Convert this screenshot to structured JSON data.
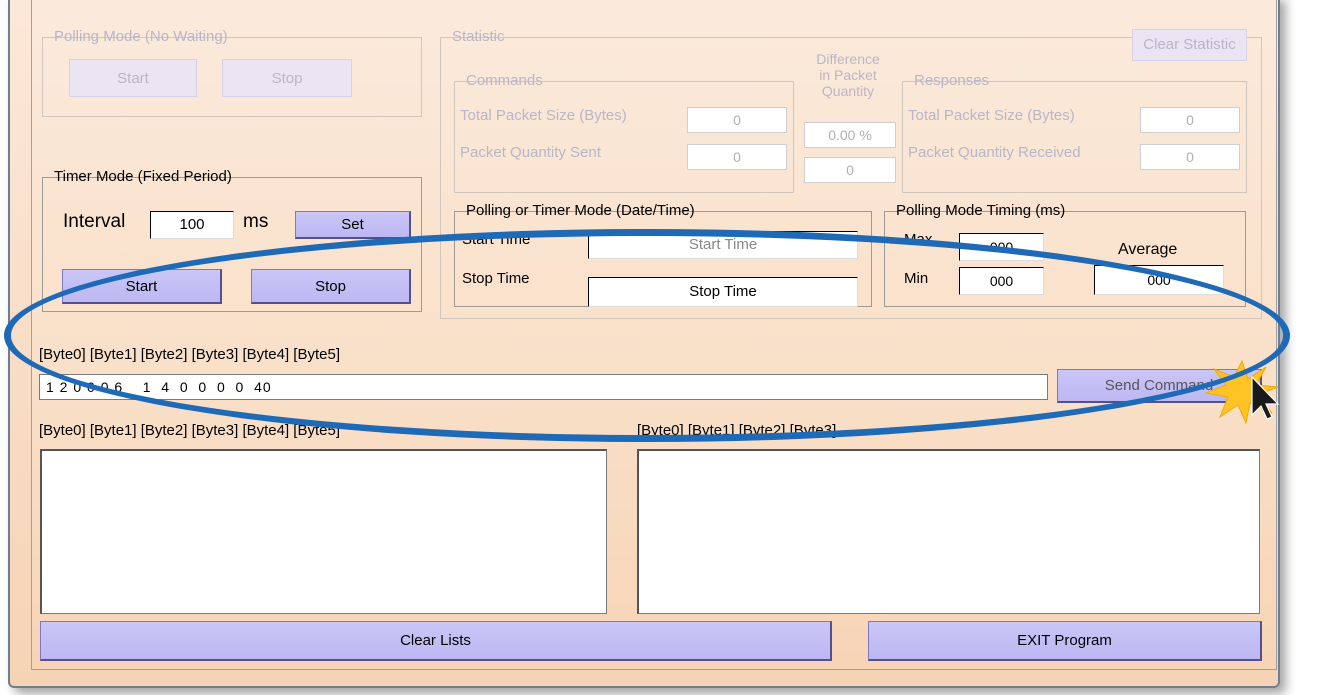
{
  "polling_mode": {
    "legend": "Polling Mode (No Waiting)",
    "start_label": "Start",
    "stop_label": "Stop"
  },
  "timer_mode": {
    "legend": "Timer Mode (Fixed Period)",
    "interval_label": "Interval",
    "interval_value": "100",
    "unit_label": "ms",
    "set_label": "Set",
    "start_label": "Start",
    "stop_label": "Stop"
  },
  "statistic": {
    "legend": "Statistic",
    "clear_label": "Clear Statistic",
    "commands": {
      "legend": "Commands",
      "total_size_label": "Total Packet Size (Bytes)",
      "total_size_value": "0",
      "quantity_label": "Packet Quantity Sent",
      "quantity_value": "0"
    },
    "difference": {
      "header_line1": "Difference",
      "header_line2": "in Packet",
      "header_line3": "Quantity",
      "percent_value": "0.00 %",
      "count_value": "0"
    },
    "responses": {
      "legend": "Responses",
      "total_size_label": "Total Packet Size (Bytes)",
      "total_size_value": "0",
      "quantity_label": "Packet Quantity Received",
      "quantity_value": "0"
    },
    "datetime": {
      "legend": "Polling  or Timer Mode  (Date/Time)",
      "start_label": "Start Time",
      "start_value": "Start Time",
      "stop_label": "Stop Time",
      "stop_value": "Stop Time"
    },
    "timing": {
      "legend": "Polling Mode Timing (ms)",
      "max_label": "Max",
      "max_value": "000",
      "min_label": "Min",
      "min_value": "000",
      "average_label": "Average",
      "average_value": "000"
    }
  },
  "command": {
    "byte_header": "[Byte0]  [Byte1]  [Byte2]  [Byte3]  [Byte4]  [Byte5]",
    "input_value": "1 2 0 0 0 6    1  4  0  0  0  0  40",
    "send_label": "Send Command"
  },
  "lists": {
    "left_header": "[Byte0]  [Byte1]  [Byte2]  [Byte3]  [Byte4]  [Byte5]",
    "right_header": "[Byte0]  [Byte1]  [Byte2]  [Byte3]"
  },
  "footer": {
    "clear_label": "Clear Lists",
    "exit_label": "EXIT Program"
  },
  "colors": {
    "highlight_ring": "#1e6ab6",
    "button_fill": "#c4c0f5",
    "panel_background": "#f9dfc7"
  }
}
